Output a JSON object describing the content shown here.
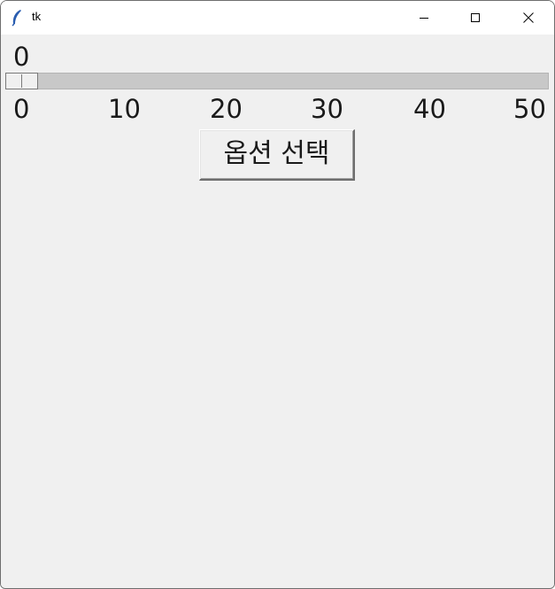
{
  "window": {
    "title": "tk",
    "icon": "feather-icon",
    "controls": [
      "minimize-icon",
      "maximize-icon",
      "close-icon"
    ]
  },
  "slider": {
    "value": 0,
    "value_label": "0",
    "min": 0,
    "max": 50,
    "ticks": [
      "0",
      "10",
      "20",
      "30",
      "40",
      "50"
    ]
  },
  "option_button": {
    "label": "옵션 선택"
  }
}
